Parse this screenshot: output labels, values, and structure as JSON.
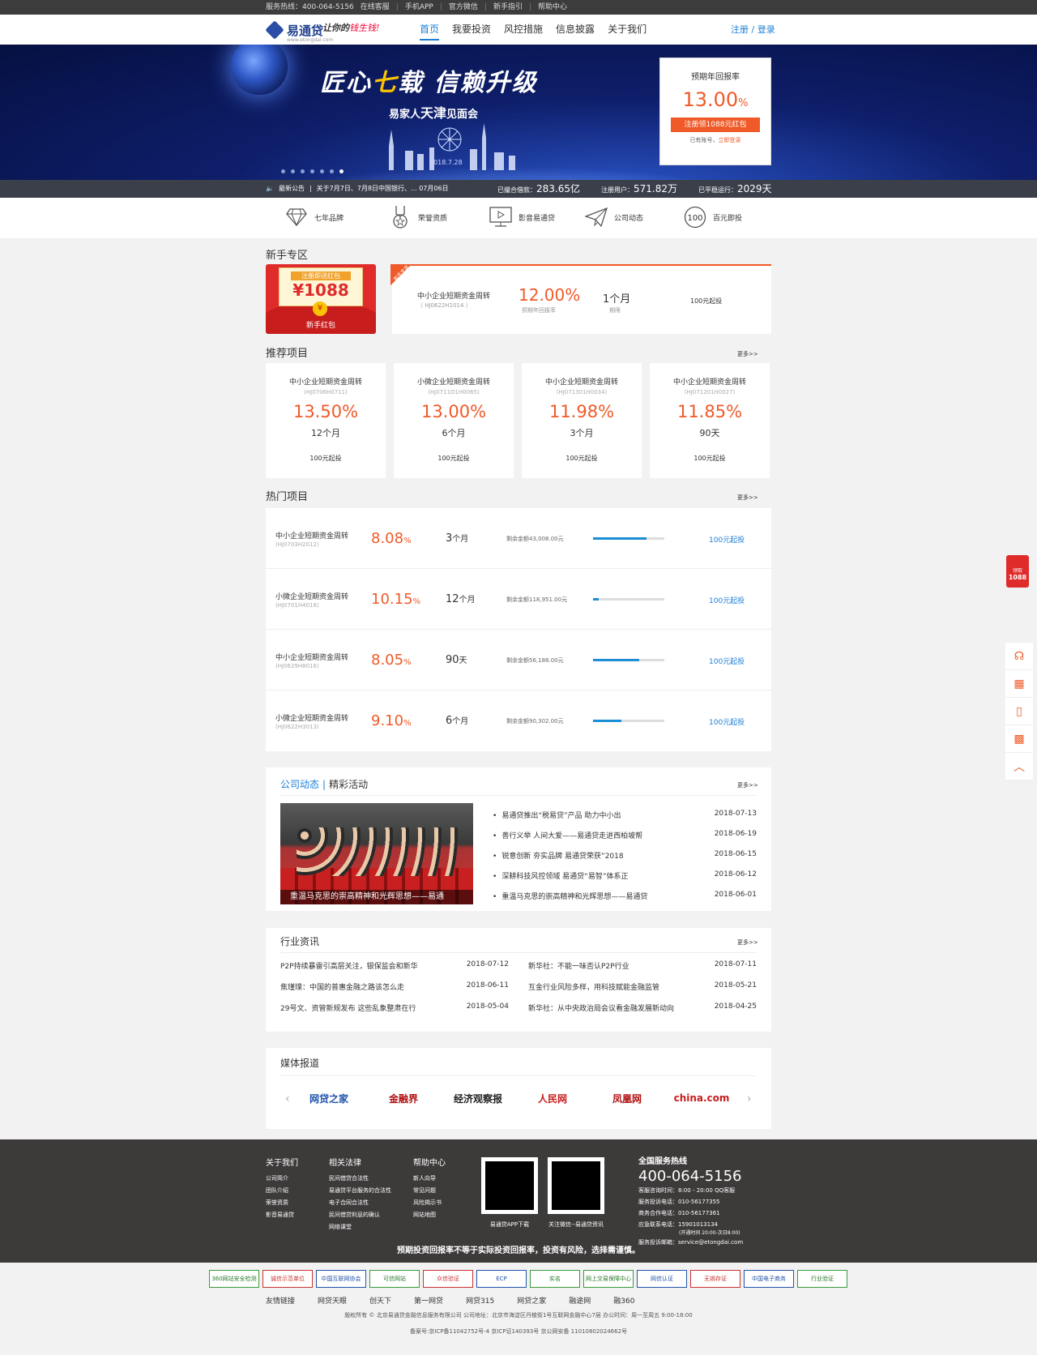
{
  "topbar": {
    "hotline": "服务热线：400-064-5156",
    "online": "在线客服",
    "app": "手机APP",
    "wechat": "官方微信",
    "guide": "新手指引",
    "help": "帮助中心"
  },
  "header": {
    "logo": "易通贷",
    "logo_sub": "www.etongdai.com",
    "slogan_a": "让你的",
    "slogan_b": "钱生钱!",
    "nav": [
      "首页",
      "我要投资",
      "风控措施",
      "信息披露",
      "关于我们"
    ],
    "auth": "注册 / 登录"
  },
  "banner": {
    "title_a": "匠心",
    "title_seven": "七",
    "title_b": "载  信赖升级",
    "sub_a": "易家人",
    "sub_tj": "天津",
    "sub_b": "见面会",
    "date": "2018.7.28",
    "rate_label": "预期年回报率",
    "rate": "13.00",
    "rate_unit": "%",
    "register_btn": "注册领1088元红包",
    "login_hint": "已有账号，",
    "login_link": "立即登录"
  },
  "statbar": {
    "notice_label": "最新公告",
    "notice": "关于7月7日、7月8日中国银行、... 07月06日",
    "s1_label": "已撮合借款：",
    "s1": "283.65亿",
    "s2_label": "注册用户：",
    "s2": "571.82万",
    "s3_label": "已平稳运行：",
    "s3": "2029天"
  },
  "features": [
    {
      "label": "七年品牌",
      "icon": "diamond-icon"
    },
    {
      "label": "荣誉资质",
      "icon": "medal-icon"
    },
    {
      "label": "影音易通贷",
      "icon": "video-icon"
    },
    {
      "label": "公司动态",
      "icon": "paper-plane-icon"
    },
    {
      "label": "百元即投",
      "icon": "hundred-icon"
    }
  ],
  "newbie": {
    "title": "新手专区",
    "envelope_top": "注册即送红包",
    "envelope_amount": "¥1088",
    "envelope_label": "新手红包",
    "ribbon": "新手专享",
    "name": "中小企业短期资金周转",
    "code": "（ HJ0622H1014 ）",
    "rate": "12.00%",
    "rate_label": "预期年回报率",
    "term": "1个月",
    "term_label": "期限",
    "min": "100元起投"
  },
  "recommend": {
    "title": "推荐项目",
    "more": "更多>>",
    "items": [
      {
        "name": "中小企业短期资金周转",
        "code": "(HJ0706H0711)",
        "rate": "13.50%",
        "term": "12个月",
        "min": "100元起投"
      },
      {
        "name": "小微企业短期资金周转",
        "code": "(HJ0711O1H0065)",
        "rate": "13.00%",
        "term": "6个月",
        "min": "100元起投"
      },
      {
        "name": "中小企业短期资金周转",
        "code": "(HJ071301H0034)",
        "rate": "11.98%",
        "term": "3个月",
        "min": "100元起投"
      },
      {
        "name": "中小企业短期资金周转",
        "code": "(HJ071201H0027)",
        "rate": "11.85%",
        "term": "90天",
        "min": "100元起投"
      }
    ]
  },
  "hot": {
    "title": "热门项目",
    "more": "更多>>",
    "items": [
      {
        "name": "中小企业短期资金周转",
        "code": "(HJ0703H2012)",
        "rate": "8.08",
        "term": "3",
        "term_unit": "个月",
        "remain": "剩余金额43,008.00元",
        "progress": 0.75,
        "min": "100元起投"
      },
      {
        "name": "小微企业短期资金周转",
        "code": "(HJ0701H4018)",
        "rate": "10.15",
        "term": "12",
        "term_unit": "个月",
        "remain": "剩余金额118,951.00元",
        "progress": 0.08,
        "min": "100元起投"
      },
      {
        "name": "中小企业短期资金周转",
        "code": "(HJ0629H8016)",
        "rate": "8.05",
        "term": "90",
        "term_unit": "天",
        "remain": "剩余金额56,188.00元",
        "progress": 0.65,
        "min": "100元起投"
      },
      {
        "name": "小微企业短期资金周转",
        "code": "(HJ0622H3013)",
        "rate": "9.10",
        "term": "6",
        "term_unit": "个月",
        "remain": "剩余金额90,302.00元",
        "progress": 0.4,
        "min": "100元起投"
      }
    ]
  },
  "company": {
    "title_a": "公司动态",
    "sep": "|",
    "title_b": "精彩活动",
    "more": "更多>>",
    "caption": "重温马克思的崇高精神和光辉思想——易通",
    "news": [
      {
        "title": "易通贷推出“税易贷”产品 助力中小出",
        "date": "2018-07-13"
      },
      {
        "title": "善行义举 人间大爱——易通贷走进西柏坡帮",
        "date": "2018-06-19"
      },
      {
        "title": "锐意创新 夯实品牌 易通贷荣获”2018",
        "date": "2018-06-15"
      },
      {
        "title": "深耕科技风控领域 易通贷“易智”体系正",
        "date": "2018-06-12"
      },
      {
        "title": "重温马克思的崇高精神和光辉思想——易通贷",
        "date": "2018-06-01"
      }
    ]
  },
  "industry": {
    "title": "行业资讯",
    "more": "更多>>",
    "left": [
      {
        "title": "P2P持续暴雷引高层关注，银保监会和新华",
        "date": "2018-07-12"
      },
      {
        "title": "焦瑾璞：中国的普惠金融之路该怎么走",
        "date": "2018-06-11"
      },
      {
        "title": "29号文、资管新规发布 这些乱象整肃在行",
        "date": "2018-05-04"
      }
    ],
    "right": [
      {
        "title": "新华社：不能一味否认P2P行业",
        "date": "2018-07-11"
      },
      {
        "title": "互金行业风险多样，用科技赋能金融监管",
        "date": "2018-05-21"
      },
      {
        "title": "新华社：从中央政治局会议看金融发展新动向",
        "date": "2018-04-25"
      }
    ]
  },
  "media": {
    "title": "媒体报道",
    "logos": [
      {
        "text": "网贷之家",
        "color": "#2255aa"
      },
      {
        "text": "金融界",
        "color": "#b01010"
      },
      {
        "text": "经济观察报",
        "color": "#222222"
      },
      {
        "text": "人民网",
        "color": "#c81d1d"
      },
      {
        "text": "凤凰网",
        "color": "#b01010"
      },
      {
        "text": "china.com",
        "color": "#c81d1d"
      }
    ]
  },
  "footer": {
    "about": {
      "h": "关于我们",
      "items": [
        "公司简介",
        "团队介绍",
        "荣誉资质",
        "影音易通贷"
      ]
    },
    "law": {
      "h": "相关法律",
      "items": [
        "民间借贷合法性",
        "易通贷平台服务的合法性",
        "电子合同合法性",
        "民间借贷利息的确认",
        "网络课堂"
      ]
    },
    "help": {
      "h": "帮助中心",
      "items": [
        "新人向导",
        "常见问题",
        "风险揭示书",
        "网站地图"
      ]
    },
    "qr1": "易通贷APP下载",
    "qr2": "关注微信--易通贷资讯",
    "hotline_h": "全国服务热线",
    "hotline": "400-064-5156",
    "lines": [
      "客服咨询时间：8:00 - 20:00  QQ客服",
      "服务投诉电话：010-56177355",
      "商务合作电话：010-56177361",
      "应急联系电话：15901013134",
      "(开通时间 20:00-次日8:00)",
      "服务投诉邮箱：service@etongdai.com"
    ],
    "warning": "预期投资回报率不等于实际投资回报率，投资有风险，选择需谨慎。"
  },
  "badges": [
    "360网站安全检测",
    "诚信示范单位",
    "中国互联网协会",
    "可信网站",
    "众信验证",
    "ECP",
    "实名",
    "网上交易保障中心",
    "网信认证",
    "无锡存证",
    "中国电子商务",
    "行业验证"
  ],
  "links": [
    "友情链接",
    "网贷天眼",
    "创天下",
    "第一网贷",
    "网贷315",
    "网贷之家",
    "融途网",
    "融360"
  ],
  "copyright": "版权所有 © 北京易通贷金融信息服务有限公司 公司地址：北京市海淀区丹棱街1号互联网金融中心7层 办公时间：周一至周五 9:00-18:00",
  "icp": "备案号:京ICP备11042752号-4    京ICP证140393号    京公网安备 11010802024662号",
  "side": {
    "redpack_top": "领取",
    "redpack": "1088"
  }
}
